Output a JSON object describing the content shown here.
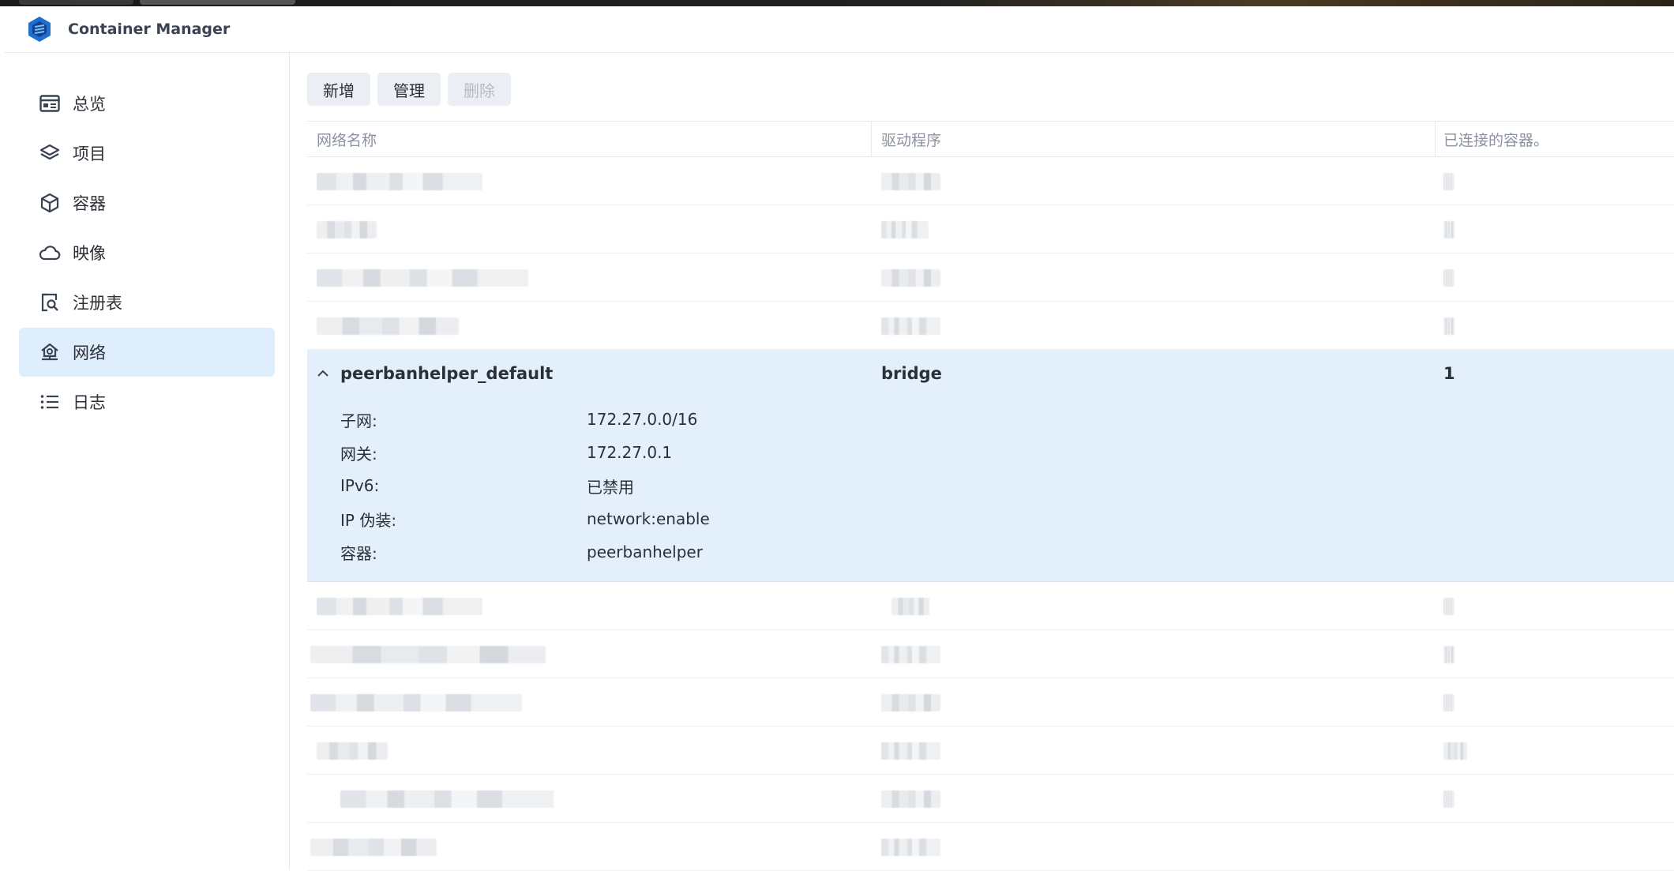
{
  "app": {
    "title": "Container Manager",
    "accent": "#1f6fd1"
  },
  "sidebar": {
    "items": [
      {
        "label": "总览",
        "icon": "overview-icon",
        "active": false
      },
      {
        "label": "项目",
        "icon": "layers-icon",
        "active": false
      },
      {
        "label": "容器",
        "icon": "cube-icon",
        "active": false
      },
      {
        "label": "映像",
        "icon": "cloud-icon",
        "active": false
      },
      {
        "label": "注册表",
        "icon": "registry-search-icon",
        "active": false
      },
      {
        "label": "网络",
        "icon": "network-icon",
        "active": true
      },
      {
        "label": "日志",
        "icon": "list-icon",
        "active": false
      }
    ]
  },
  "toolbar": {
    "add_label": "新增",
    "manage_label": "管理",
    "delete_label": "删除"
  },
  "table": {
    "columns": [
      "网络名称",
      "驱动程序",
      "已连接的容器。"
    ],
    "expanded_row": {
      "name": "peerbanhelper_default",
      "driver": "bridge",
      "connected": "1",
      "details": [
        {
          "label": "子网:",
          "value": "172.27.0.0/16"
        },
        {
          "label": "网关:",
          "value": "172.27.0.1"
        },
        {
          "label": "IPv6:",
          "value": "已禁用"
        },
        {
          "label": "IP 伪装:",
          "value": "network:enable"
        },
        {
          "label": "容器:",
          "value": "peerbanhelper"
        }
      ]
    }
  }
}
